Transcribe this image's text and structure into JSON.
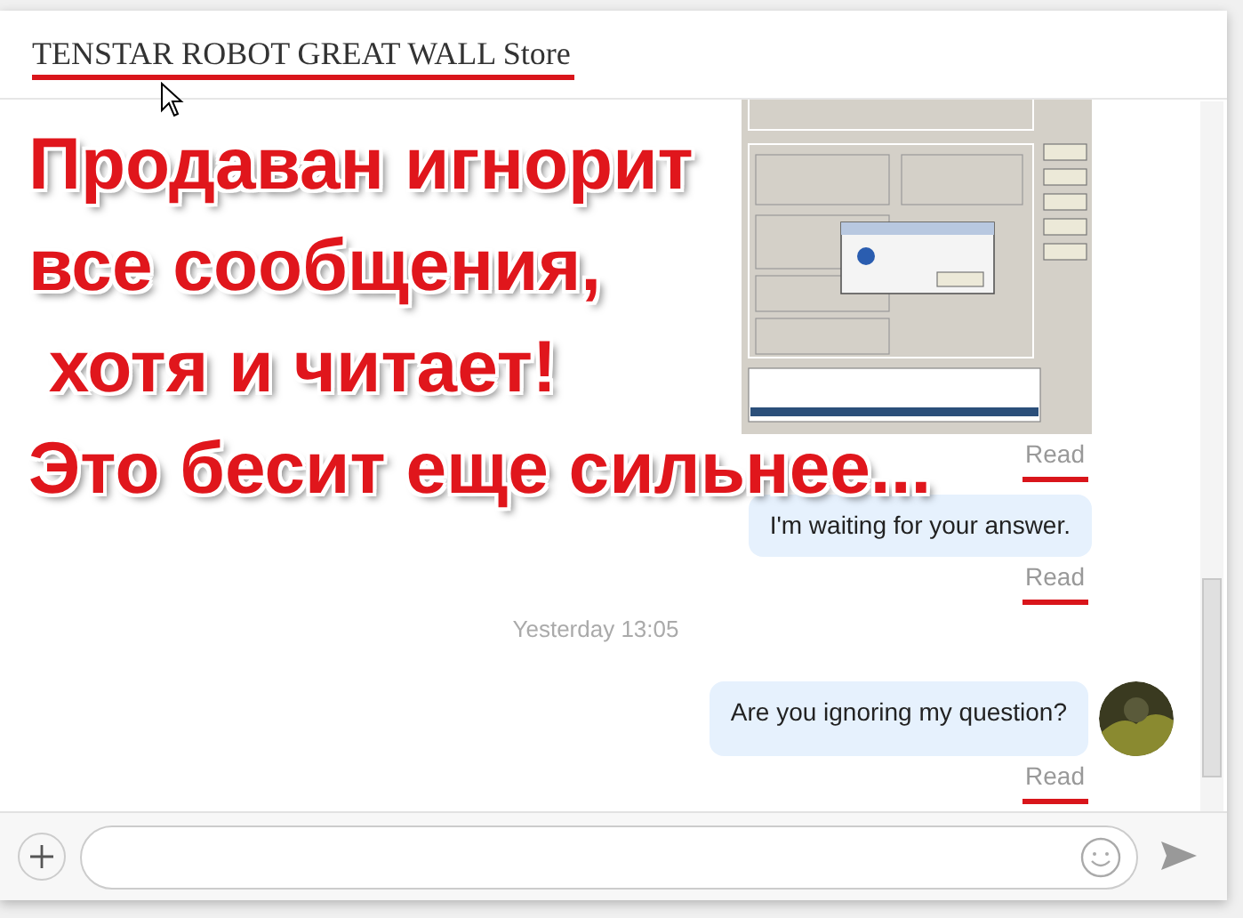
{
  "header": {
    "title": "TENSTAR ROBOT GREAT WALL Store"
  },
  "messages": [
    {
      "kind": "screenshot",
      "status": "Read",
      "avatar": false
    },
    {
      "kind": "text",
      "text": "I'm waiting for your answer.",
      "status": "Read",
      "avatar": false
    },
    {
      "kind": "time",
      "text": "Yesterday 13:05"
    },
    {
      "kind": "text",
      "text": "Are you ignoring my question?",
      "status": "Read",
      "avatar": true
    }
  ],
  "overlay": {
    "lines": [
      "Продаван игнорит",
      "все сообщения,",
      " хотя и читает!",
      "Это бесит еще сильнее..."
    ]
  }
}
